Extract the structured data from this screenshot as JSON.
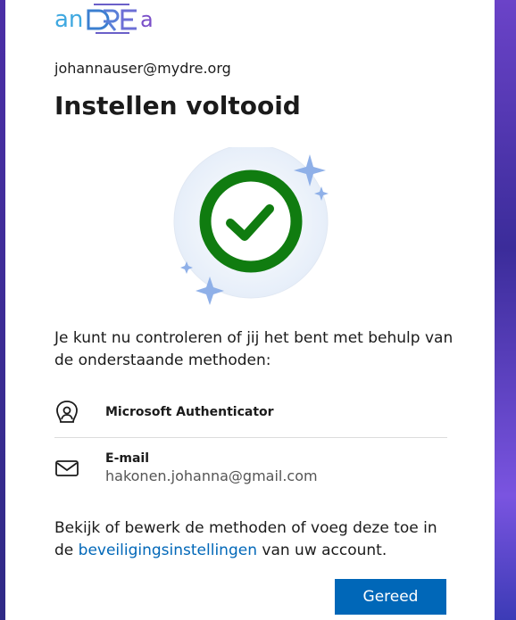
{
  "brand": {
    "logo_text": "anDREa"
  },
  "account": {
    "email": "johannauser@mydre.org"
  },
  "page": {
    "title": "Instellen voltooid"
  },
  "description": "Je kunt nu controleren of jij het bent met behulp van de onderstaande methoden:",
  "methods": [
    {
      "name": "Microsoft Authenticator",
      "icon": "authenticator-icon"
    },
    {
      "name": "E-mail",
      "detail": "hakonen.johanna@gmail.com",
      "icon": "mail-icon"
    }
  ],
  "footer": {
    "text_before": "Bekijk of bewerk de methoden of voeg deze toe in de ",
    "link": "beveiligingsinstellingen",
    "text_after": " van uw account."
  },
  "actions": {
    "done_label": "Gereed"
  },
  "colors": {
    "accent": "#0067b8",
    "success": "#107c10"
  }
}
